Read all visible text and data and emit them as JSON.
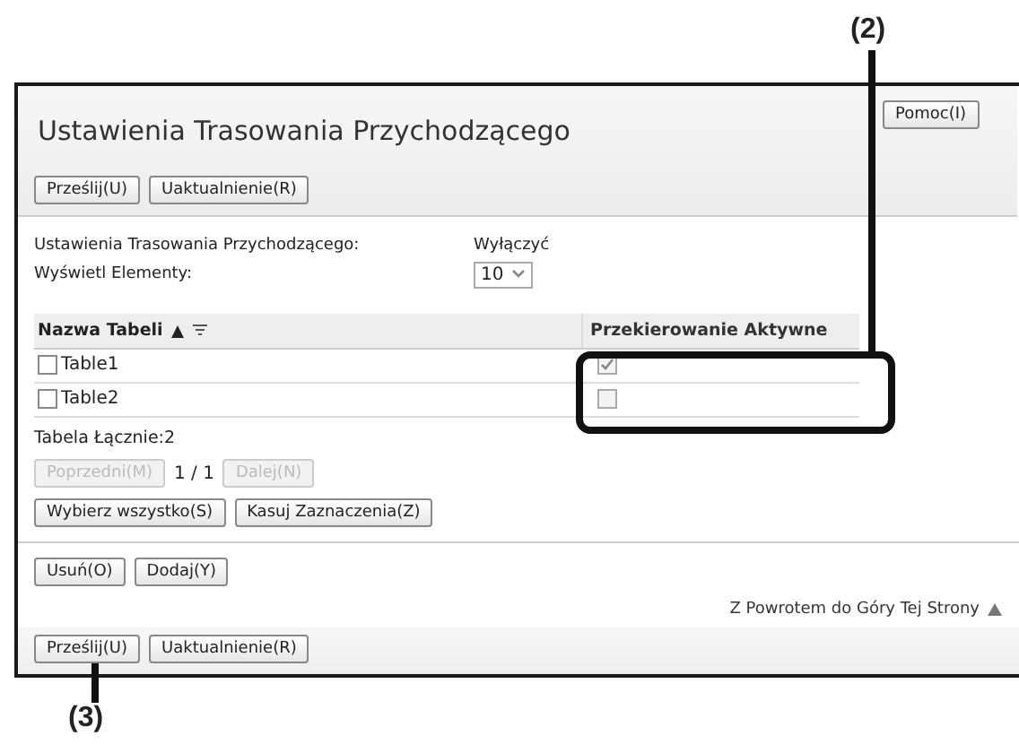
{
  "header": {
    "title": "Ustawienia Trasowania Przychodzącego",
    "help_button": "Pomoc(I)"
  },
  "top_buttons": [
    "Prześlij(U)",
    "Uaktualnienie(R)"
  ],
  "settings": [
    {
      "label": "Ustawienia Trasowania Przychodzącego:",
      "kind": "text",
      "value": "Wyłączyć"
    },
    {
      "label": "Wyświetl Elementy:",
      "kind": "select",
      "value": "10"
    }
  ],
  "table": {
    "columns": [
      "Nazwa Tabeli",
      "Przekierowanie Aktywne"
    ],
    "rows": [
      {
        "name": "Table1",
        "checked": false,
        "active": true
      },
      {
        "name": "Table2",
        "checked": false,
        "active": false
      }
    ]
  },
  "total": "Tabela Łącznie:2",
  "pager": {
    "prev": "Poprzedni(M)",
    "page": "1 / 1",
    "next": "Dalej(N)",
    "disabled": true
  },
  "select_buttons": [
    "Wybierz wszystko(S)",
    "Kasuj Zaznaczenia(Z)"
  ],
  "action_buttons": [
    "Usuń(O)",
    "Dodaj(Y)"
  ],
  "back_to_top": "Z Powrotem do Góry Tej Strony",
  "bottom_buttons": [
    "Prześlij(U)",
    "Uaktualnienie(R)"
  ],
  "callouts": [
    "(2)",
    "(3)"
  ]
}
